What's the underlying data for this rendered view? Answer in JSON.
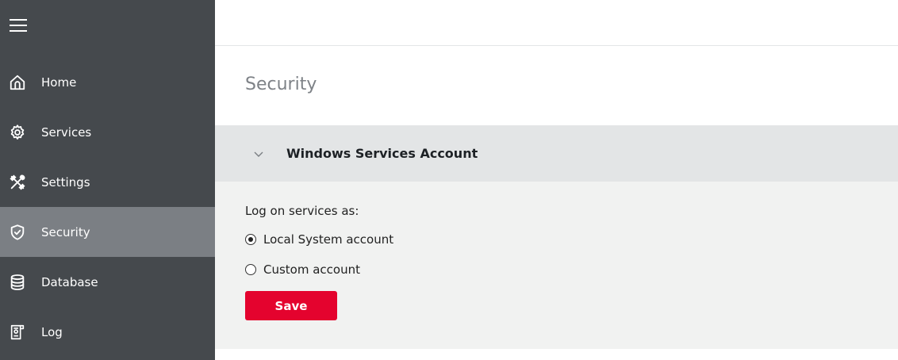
{
  "sidebar": {
    "items": [
      {
        "label": "Home",
        "icon": "home-icon"
      },
      {
        "label": "Services",
        "icon": "gear-icon"
      },
      {
        "label": "Settings",
        "icon": "tools-icon"
      },
      {
        "label": "Security",
        "icon": "shield-icon",
        "active": true
      },
      {
        "label": "Database",
        "icon": "database-icon"
      },
      {
        "label": "Log",
        "icon": "log-icon"
      }
    ]
  },
  "main": {
    "title": "Security",
    "section": {
      "title": "Windows Services Account",
      "log_on_label": "Log on services as:",
      "options": [
        {
          "label": "Local System account",
          "checked": true
        },
        {
          "label": "Custom account",
          "checked": false
        }
      ],
      "save_label": "Save"
    }
  },
  "colors": {
    "sidebar_bg": "#45494d",
    "active_item_bg": "#7b7f84",
    "accent": "#e4032e"
  }
}
